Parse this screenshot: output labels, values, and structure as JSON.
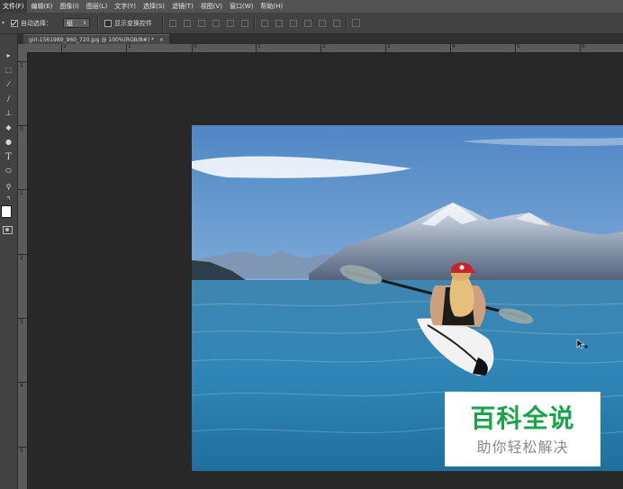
{
  "menubar": {
    "items": [
      {
        "label": "文件(F)",
        "active": true
      },
      {
        "label": "编辑(E)"
      },
      {
        "label": "图像(I)"
      },
      {
        "label": "图层(L)"
      },
      {
        "label": "文字(Y)"
      },
      {
        "label": "选择(S)"
      },
      {
        "label": "滤镜(T)"
      },
      {
        "label": "视图(V)"
      },
      {
        "label": "窗口(W)"
      },
      {
        "label": "帮助(H)"
      }
    ]
  },
  "options": {
    "auto_select_label": "自动选择：",
    "auto_select_checked": true,
    "auto_select_target": "组",
    "show_transform_label": "显示变换控件",
    "show_transform_checked": false
  },
  "document": {
    "tab_title": "girl-1561989_960_720.jpg @ 100%(RGB/8#) *",
    "close_glyph": "×"
  },
  "rulers": {
    "top_labels": [
      "2",
      "1",
      "0",
      "1",
      "2",
      "3",
      "4",
      "5",
      "6"
    ],
    "left_labels": [
      "1",
      "0",
      "1",
      "2",
      "3",
      "4",
      "5"
    ]
  },
  "tools": [
    {
      "name": "move-tool-icon",
      "glyph": "▸"
    },
    {
      "name": "marquee-tool-icon",
      "glyph": "⬚"
    },
    {
      "name": "eyedropper-tool-icon",
      "glyph": "⁄"
    },
    {
      "name": "brush-tool-icon",
      "glyph": "∕"
    },
    {
      "name": "clone-stamp-tool-icon",
      "glyph": "⊥"
    },
    {
      "name": "paint-bucket-tool-icon",
      "glyph": "◆"
    },
    {
      "name": "dodge-tool-icon",
      "glyph": "●"
    },
    {
      "name": "type-tool-icon",
      "glyph": "T"
    },
    {
      "name": "shape-tool-icon",
      "glyph": "⬭"
    },
    {
      "name": "zoom-tool-icon",
      "glyph": "⚲"
    },
    {
      "name": "swap-colors-icon",
      "glyph": "↰"
    }
  ],
  "colors": {
    "foreground": "#ffffff",
    "background": "#000000",
    "watermark_green": "#1aa44a"
  },
  "watermark": {
    "title": "百科全说",
    "subtitle": "助你轻松解决"
  }
}
